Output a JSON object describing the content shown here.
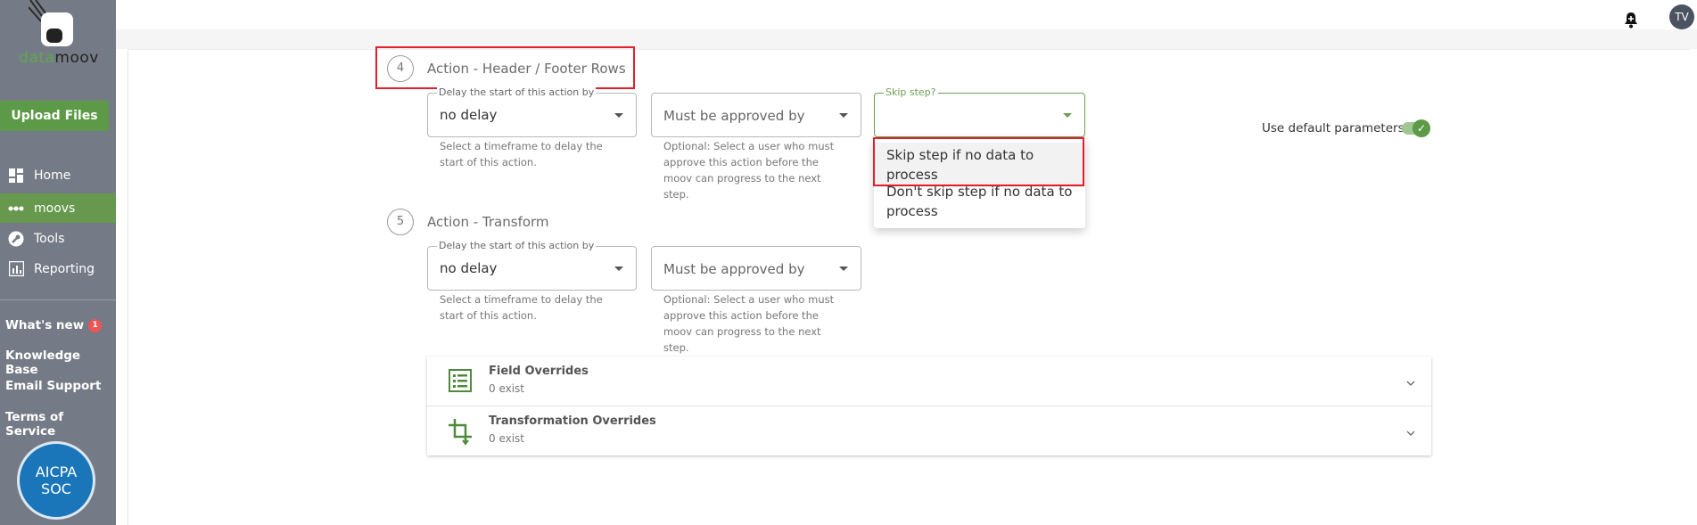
{
  "sidebar": {
    "logo_part1": "data",
    "logo_part2": "moov",
    "upload_label": "Upload Files",
    "nav": [
      {
        "label": "Home",
        "icon": "dashboard-icon"
      },
      {
        "label": "moovs",
        "icon": "dots-icon"
      },
      {
        "label": "Tools",
        "icon": "wrench-icon"
      },
      {
        "label": "Reporting",
        "icon": "chart-icon"
      }
    ],
    "links": [
      {
        "label": "What's new",
        "badge": "1"
      },
      {
        "label": "Knowledge Base"
      },
      {
        "label": "Email Support"
      },
      {
        "label": "Terms of Service"
      }
    ],
    "aicpa_line1": "AICPA",
    "aicpa_line2": "SOC"
  },
  "topbar": {
    "avatar": "TV"
  },
  "step4": {
    "number": "4",
    "title": "Action - Header / Footer Rows",
    "delay": {
      "legend": "Delay the start of this action by",
      "value": "no delay",
      "helper": "Select a timeframe to delay the start of this action."
    },
    "approval": {
      "placeholder": "Must be approved by",
      "helper": "Optional: Select a user who must approve this action before the moov can progress to the next step."
    },
    "skip": {
      "legend": "Skip step?",
      "value": ""
    },
    "dropdown": [
      "Skip step if no data to process",
      "Don't skip step if no data to process"
    ],
    "toggle_label": "Use default parameters"
  },
  "step5": {
    "number": "5",
    "title": "Action - Transform",
    "delay": {
      "legend": "Delay the start of this action by",
      "value": "no delay",
      "helper": "Select a timeframe to delay the start of this action."
    },
    "approval": {
      "placeholder": "Must be approved by",
      "helper": "Optional: Select a user who must approve this action before the moov can progress to the next step."
    }
  },
  "overrides": [
    {
      "title": "Field Overrides",
      "subtitle": "0 exist"
    },
    {
      "title": "Transformation Overrides",
      "subtitle": "0 exist"
    }
  ],
  "colors": {
    "brand_green": "#5c9a47",
    "sidebar": "#757b86",
    "highlight": "#e0202a"
  }
}
